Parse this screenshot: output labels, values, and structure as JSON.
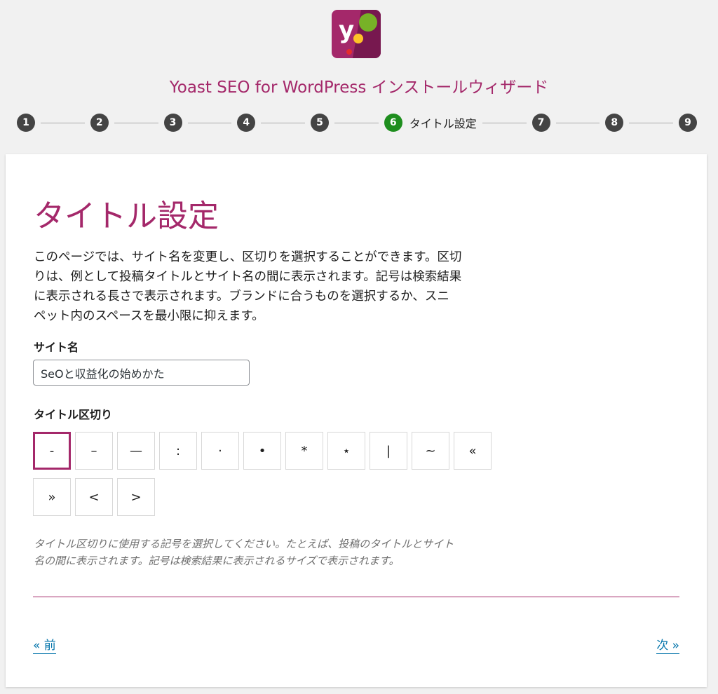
{
  "wizard": {
    "title": "Yoast SEO for WordPress インストールウィザード",
    "steps": [
      "1",
      "2",
      "3",
      "4",
      "5",
      "6",
      "7",
      "8",
      "9"
    ],
    "active_step_label": "タイトル設定"
  },
  "page": {
    "title": "タイトル設定",
    "intro_lines": [
      "このページでは、サイト名を変更し、区切りを選択することができます。区切",
      "りは、例として投稿タイトルとサイト名の間に表示されます。記号は検索結果",
      "に表示される長さで表示されます。ブランドに合うものを選択するか、スニ",
      "ペット内のスペースを最小限に抑えます。"
    ],
    "site_name": {
      "label": "サイト名",
      "value": "SeOと収益化の始めかた"
    },
    "separator": {
      "label": "タイトル区切り",
      "options": [
        "-",
        "–",
        "—",
        ":",
        "·",
        "•",
        "*",
        "⋆",
        "|",
        "~",
        "«",
        "»",
        "<",
        ">"
      ],
      "selected": "-"
    },
    "hint_lines": [
      "タイトル区切りに使用する記号を選択してください。たとえば、投稿のタイトルとサイト",
      "名の間に表示されます。記号は検索結果に表示されるサイズで表示されます。"
    ]
  },
  "nav": {
    "prev_label": "« 前",
    "next_label": "次 »"
  },
  "colors": {
    "brand": "#a4286a",
    "active_step": "#1e8e1e",
    "link": "#0073aa"
  },
  "icons": {
    "logo": "yoast-logo-icon"
  }
}
